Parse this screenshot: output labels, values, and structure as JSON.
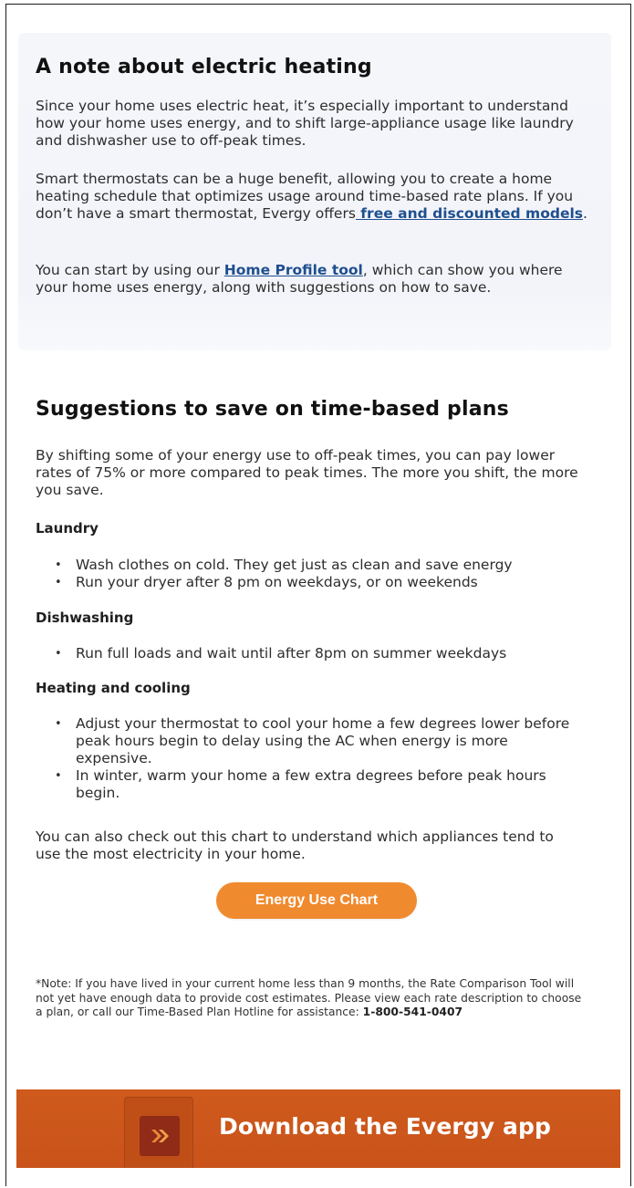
{
  "electric_note": {
    "title": "A note about electric heating",
    "p1": "Since your home uses electric heat, it’s especially important to understand how your home uses energy, and to shift large-appliance usage like laundry and dishwasher use to off-peak times.",
    "p2_before": "Smart thermostats can be a huge benefit, allowing you to create a home heating schedule that optimizes usage around time-based rate plans. If you don’t have a smart thermostat, Evergy offers",
    "p2_link": " free and discounted models",
    "p2_after": ".",
    "p3_before": "You can start by using our ",
    "p3_link": "Home Profile tool",
    "p3_after": ", which can show you where your home uses energy, along with suggestions on how to save."
  },
  "suggestions": {
    "title": "Suggestions to save on time-based plans",
    "intro": "By shifting some of your energy use to off-peak times, you can pay lower rates of 75% or more compared to peak times. The more you shift, the more you save.",
    "laundry": {
      "heading": "Laundry",
      "items": [
        "Wash clothes on cold. They get just as clean and save energy",
        "Run your dryer after 8 pm on weekdays, or on weekends"
      ]
    },
    "dishwashing": {
      "heading": "Dishwashing",
      "items": [
        "Run full loads and wait until after 8pm on summer weekdays"
      ]
    },
    "heating_cooling": {
      "heading": "Heating and cooling",
      "items": [
        "Adjust your thermostat to cool your home a few degrees lower before peak hours begin to delay using the AC when energy is more expensive.",
        "In winter, warm your home a few extra degrees before peak hours begin."
      ]
    },
    "chart_text": "You can also check out this chart to understand which appliances tend to use the most electricity in your home.",
    "chart_button": "Energy Use Chart"
  },
  "footnote": {
    "text": "*Note: If you have lived in your current home less than 9 months, the Rate Comparison Tool will not yet have enough data to provide cost estimates. Please view each rate description to choose a plan, or call our Time-Based Plan Hotline for assistance: ",
    "phone": "1-800-541-0407"
  },
  "app_banner": {
    "text": "Download the Evergy app",
    "icon": "evergy-app-icon",
    "color": "#cf5a1c"
  },
  "colors": {
    "button": "#f08a2e",
    "link": "#1f4f8f"
  }
}
